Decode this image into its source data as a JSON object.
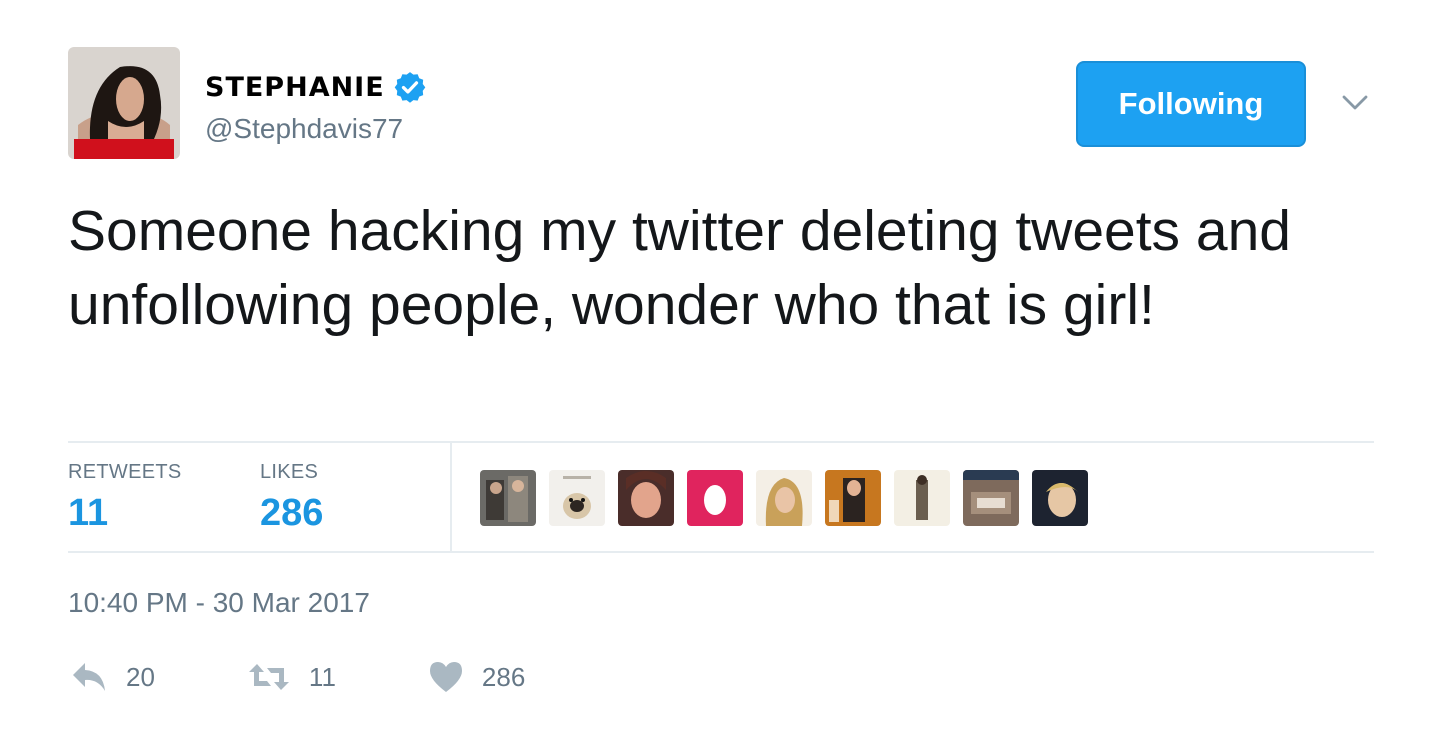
{
  "user": {
    "display_name": "STEPHANIE",
    "handle": "@Stephdavis77",
    "verified_icon": "verified-badge-icon",
    "avatar_icon": "profile-avatar"
  },
  "follow_button": {
    "label": "Following"
  },
  "menu_icon": "chevron-down-icon",
  "tweet": {
    "text": "Someone hacking my twitter deleting tweets and unfollowing people, wonder who that is girl!"
  },
  "stats": {
    "retweets_label": "RETWEETS",
    "retweets_value": "11",
    "likes_label": "LIKES",
    "likes_value": "286"
  },
  "likers": [
    "liker-avatar-1",
    "liker-avatar-2",
    "liker-avatar-3",
    "liker-avatar-4",
    "liker-avatar-5",
    "liker-avatar-6",
    "liker-avatar-7",
    "liker-avatar-8",
    "liker-avatar-9"
  ],
  "timestamp": "10:40 PM - 30 Mar 2017",
  "actions": {
    "reply_count": "20",
    "retweet_count": "11",
    "like_count": "286"
  },
  "colors": {
    "accent": "#1da1f2",
    "stat_value": "#1b95e0",
    "muted": "#657786",
    "text": "#14171a",
    "divider": "#e6ecf0"
  }
}
